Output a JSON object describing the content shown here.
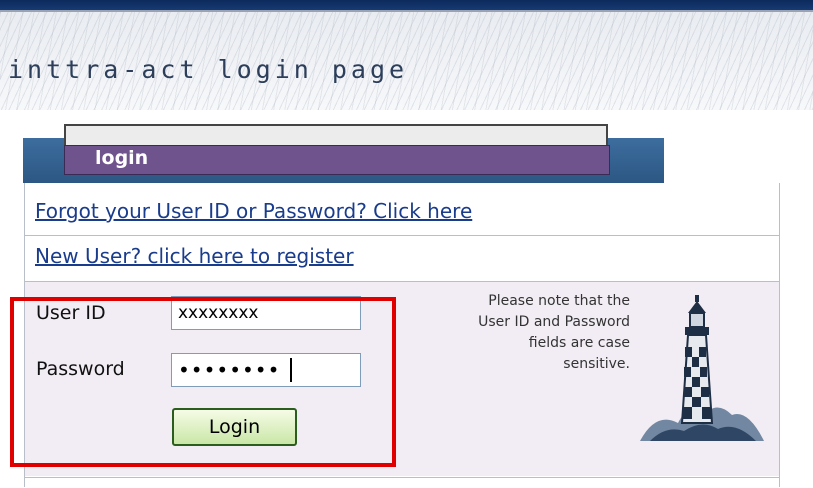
{
  "header": {
    "title": "inttra-act login page"
  },
  "login_tab": {
    "label": "login"
  },
  "links": {
    "forgot": "Forgot your User ID or Password? Click here",
    "register": "New User? click here to register"
  },
  "form": {
    "user_id_label": "User ID",
    "user_id_value": "xxxxxxxx",
    "password_label": "Password",
    "password_value": "••••••••",
    "login_button": "Login"
  },
  "note": {
    "line1": "Please note that the",
    "line2": "User ID and Password",
    "line3": "fields are case",
    "line4": "sensitive."
  },
  "colors": {
    "tab_blue": "#2c5784",
    "tab_purple": "#6f538c",
    "link_blue": "#1a3c8c",
    "form_bg": "#f2edf4",
    "highlight_red": "#e00000"
  }
}
